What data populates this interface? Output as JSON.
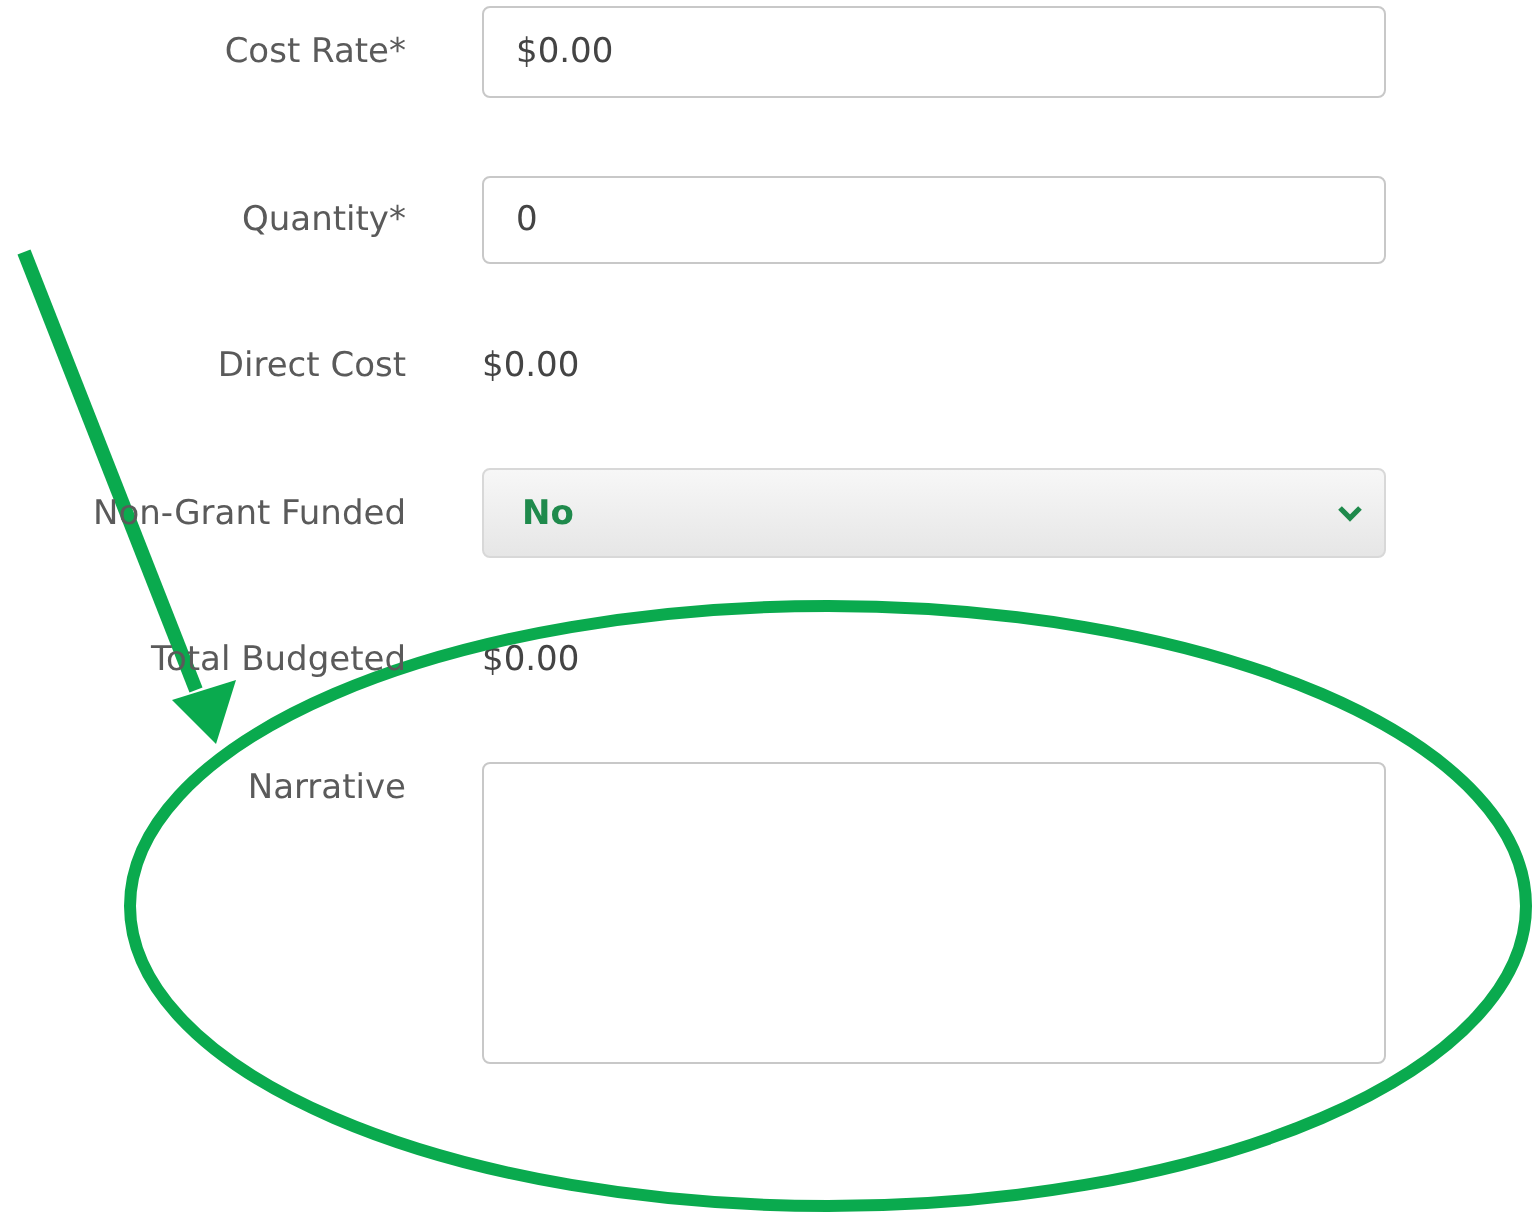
{
  "fields": [
    {
      "kind": "input",
      "label": "Cost Rate*",
      "value": "$0.00"
    },
    {
      "kind": "input",
      "label": "Quantity*",
      "value": "0"
    },
    {
      "kind": "text",
      "label": "Direct Cost",
      "value": "$0.00"
    },
    {
      "kind": "select",
      "label": "Non-Grant Funded",
      "value": "No"
    },
    {
      "kind": "text",
      "label": "Total Budgeted",
      "value": "$0.00"
    },
    {
      "kind": "textarea",
      "label": "Narrative"
    }
  ]
}
